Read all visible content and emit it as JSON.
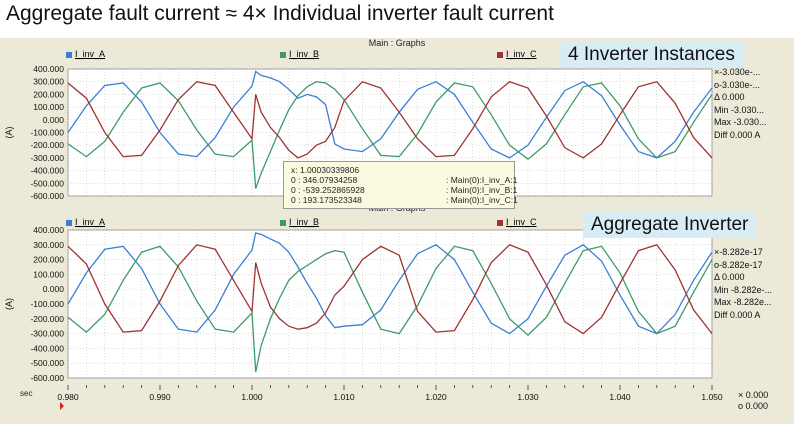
{
  "page_title": "Aggregate fault current ≈ 4× Individual inverter fault current",
  "chart_data": [
    {
      "type": "line",
      "panel_title": "Main : Graphs",
      "callout": "4 Inverter Instances",
      "ylabel": "(A)",
      "ylim": [
        -600,
        400
      ],
      "yticks": [
        "400.000",
        "300.000",
        "200.000",
        "100.000",
        "0.000",
        "-100.000",
        "-200.000",
        "-300.000",
        "-400.000",
        "-500.000",
        "-600.000"
      ],
      "xlim": [
        0.98,
        1.05
      ],
      "grid": true,
      "legend_placement": "top",
      "series": [
        {
          "name": "I_inv_A",
          "color": "#3a7fd5",
          "x": [
            0.98,
            0.982,
            0.984,
            0.986,
            0.988,
            0.99,
            0.992,
            0.994,
            0.996,
            0.998,
            1.0,
            1.0004,
            1.001,
            1.002,
            1.003,
            1.004,
            1.005,
            1.006,
            1.007,
            1.008,
            1.009,
            1.01,
            1.012,
            1.014,
            1.016,
            1.018,
            1.02,
            1.022,
            1.024,
            1.026,
            1.028,
            1.03,
            1.032,
            1.034,
            1.036,
            1.038,
            1.04,
            1.042,
            1.044,
            1.046,
            1.048,
            1.05
          ],
          "y": [
            -100,
            110,
            270,
            290,
            140,
            -100,
            -270,
            -290,
            -140,
            100,
            265,
            380,
            350,
            330,
            300,
            240,
            170,
            200,
            180,
            120,
            -190,
            -230,
            -250,
            -150,
            60,
            240,
            300,
            200,
            -20,
            -230,
            -300,
            -200,
            20,
            230,
            300,
            190,
            -40,
            -250,
            -300,
            -170,
            60,
            250
          ]
        },
        {
          "name": "I_inv_B",
          "color": "#3f9a6a",
          "x": [
            0.98,
            0.982,
            0.984,
            0.986,
            0.988,
            0.99,
            0.992,
            0.994,
            0.996,
            0.998,
            1.0,
            1.0004,
            1.001,
            1.002,
            1.003,
            1.004,
            1.005,
            1.006,
            1.007,
            1.008,
            1.009,
            1.01,
            1.012,
            1.014,
            1.016,
            1.018,
            1.02,
            1.022,
            1.024,
            1.026,
            1.028,
            1.03,
            1.032,
            1.034,
            1.036,
            1.038,
            1.04,
            1.042,
            1.044,
            1.046,
            1.048,
            1.05
          ],
          "y": [
            -190,
            -290,
            -170,
            60,
            250,
            290,
            150,
            -80,
            -270,
            -290,
            -160,
            -540,
            -420,
            -250,
            -80,
            80,
            190,
            260,
            300,
            290,
            240,
            160,
            -70,
            -280,
            -290,
            -110,
            140,
            290,
            260,
            40,
            -200,
            -310,
            -190,
            40,
            260,
            290,
            110,
            -150,
            -300,
            -250,
            -20,
            200
          ]
        },
        {
          "name": "I_inv_C",
          "color": "#a03232",
          "x": [
            0.98,
            0.982,
            0.984,
            0.986,
            0.988,
            0.99,
            0.992,
            0.994,
            0.996,
            0.998,
            1.0,
            1.0004,
            1.001,
            1.002,
            1.003,
            1.004,
            1.005,
            1.006,
            1.007,
            1.008,
            1.009,
            1.01,
            1.012,
            1.014,
            1.016,
            1.018,
            1.02,
            1.022,
            1.024,
            1.026,
            1.028,
            1.03,
            1.032,
            1.034,
            1.036,
            1.038,
            1.04,
            1.042,
            1.044,
            1.046,
            1.048,
            1.05
          ],
          "y": [
            290,
            170,
            -100,
            -290,
            -280,
            -80,
            160,
            300,
            270,
            60,
            -150,
            200,
            60,
            -60,
            -140,
            -240,
            -300,
            -270,
            -200,
            -170,
            -60,
            150,
            300,
            250,
            60,
            -150,
            -290,
            -280,
            -70,
            180,
            300,
            250,
            30,
            -220,
            -300,
            -190,
            40,
            260,
            300,
            130,
            -140,
            -300
          ]
        }
      ],
      "side_panel": [
        "×-3.030e-...",
        "o-3.030e-...",
        "Δ 0.000",
        "Min -3.030...",
        "Max -3.030...",
        "Diff 0.000 A"
      ],
      "tooltip": {
        "x_line": "x: 1.00030339806",
        "rows": [
          {
            "label": "0  : 346.07934258",
            "src": ": Main(0):I_inv_A:1"
          },
          {
            "label": "0  : -539.252865928",
            "src": ": Main(0):I_inv_B:1"
          },
          {
            "label": "0  : 193.173523348",
            "src": ": Main(0):I_inv_C:1"
          }
        ]
      }
    },
    {
      "type": "line",
      "panel_title": "Main : Graphs",
      "callout": "Aggregate Inverter",
      "ylabel": "(A)",
      "ylim": [
        -600,
        400
      ],
      "yticks": [
        "400.000",
        "300.000",
        "200.000",
        "100.000",
        "0.000",
        "-100.000",
        "-200.000",
        "-300.000",
        "-400.000",
        "-500.000",
        "-600.000"
      ],
      "xlim": [
        0.98,
        1.05
      ],
      "xticks": [
        "0.980",
        "0.990",
        "1.000",
        "1.010",
        "1.020",
        "1.030",
        "1.040",
        "1.050"
      ],
      "xlabel": "sec",
      "grid": true,
      "legend_placement": "top",
      "series": [
        {
          "name": "I_inv_A",
          "color": "#3a7fd5",
          "x": [
            0.98,
            0.982,
            0.984,
            0.986,
            0.988,
            0.99,
            0.992,
            0.994,
            0.996,
            0.998,
            1.0,
            1.0004,
            1.001,
            1.002,
            1.003,
            1.004,
            1.005,
            1.006,
            1.007,
            1.008,
            1.009,
            1.01,
            1.012,
            1.014,
            1.016,
            1.018,
            1.02,
            1.022,
            1.024,
            1.026,
            1.028,
            1.03,
            1.032,
            1.034,
            1.036,
            1.038,
            1.04,
            1.042,
            1.044,
            1.046,
            1.048,
            1.05
          ],
          "y": [
            -100,
            110,
            270,
            290,
            140,
            -100,
            -270,
            -290,
            -140,
            100,
            265,
            380,
            370,
            340,
            310,
            250,
            150,
            40,
            -60,
            -180,
            -260,
            -250,
            -240,
            -140,
            60,
            240,
            300,
            200,
            -20,
            -230,
            -300,
            -200,
            20,
            230,
            300,
            190,
            -40,
            -250,
            -300,
            -170,
            60,
            250
          ]
        },
        {
          "name": "I_inv_B",
          "color": "#3f9a6a",
          "x": [
            0.98,
            0.982,
            0.984,
            0.986,
            0.988,
            0.99,
            0.992,
            0.994,
            0.996,
            0.998,
            1.0,
            1.0004,
            1.001,
            1.002,
            1.003,
            1.004,
            1.005,
            1.006,
            1.007,
            1.008,
            1.009,
            1.01,
            1.012,
            1.014,
            1.016,
            1.018,
            1.02,
            1.022,
            1.024,
            1.026,
            1.028,
            1.03,
            1.032,
            1.034,
            1.036,
            1.038,
            1.04,
            1.042,
            1.044,
            1.046,
            1.048,
            1.05
          ],
          "y": [
            -190,
            -290,
            -170,
            60,
            250,
            290,
            150,
            -80,
            -270,
            -290,
            -160,
            -560,
            -380,
            -200,
            -60,
            60,
            120,
            160,
            200,
            240,
            260,
            250,
            -20,
            -270,
            -300,
            -110,
            140,
            290,
            260,
            40,
            -200,
            -310,
            -190,
            40,
            260,
            290,
            110,
            -150,
            -300,
            -250,
            -20,
            200
          ]
        },
        {
          "name": "I_inv_C",
          "color": "#a03232",
          "x": [
            0.98,
            0.982,
            0.984,
            0.986,
            0.988,
            0.99,
            0.992,
            0.994,
            0.996,
            0.998,
            1.0,
            1.0004,
            1.001,
            1.002,
            1.003,
            1.004,
            1.005,
            1.006,
            1.007,
            1.008,
            1.009,
            1.01,
            1.012,
            1.014,
            1.016,
            1.018,
            1.02,
            1.022,
            1.024,
            1.026,
            1.028,
            1.03,
            1.032,
            1.034,
            1.036,
            1.038,
            1.04,
            1.042,
            1.044,
            1.046,
            1.048,
            1.05
          ],
          "y": [
            290,
            170,
            -100,
            -290,
            -280,
            -80,
            160,
            300,
            270,
            60,
            -150,
            180,
            40,
            -120,
            -200,
            -250,
            -270,
            -260,
            -230,
            -160,
            -40,
            20,
            200,
            290,
            230,
            -150,
            -290,
            -280,
            -70,
            180,
            300,
            250,
            30,
            -220,
            -300,
            -190,
            40,
            260,
            300,
            130,
            -140,
            -300
          ]
        }
      ],
      "side_panel": [
        "×-8.282e-17",
        "o-8.282e-17",
        "Δ 0.000",
        "Min -8.282e-...",
        "Max -8.282e...",
        "Diff 0.000 A"
      ],
      "bottom_readout": [
        "× 0.000",
        "o 0.000"
      ]
    }
  ]
}
